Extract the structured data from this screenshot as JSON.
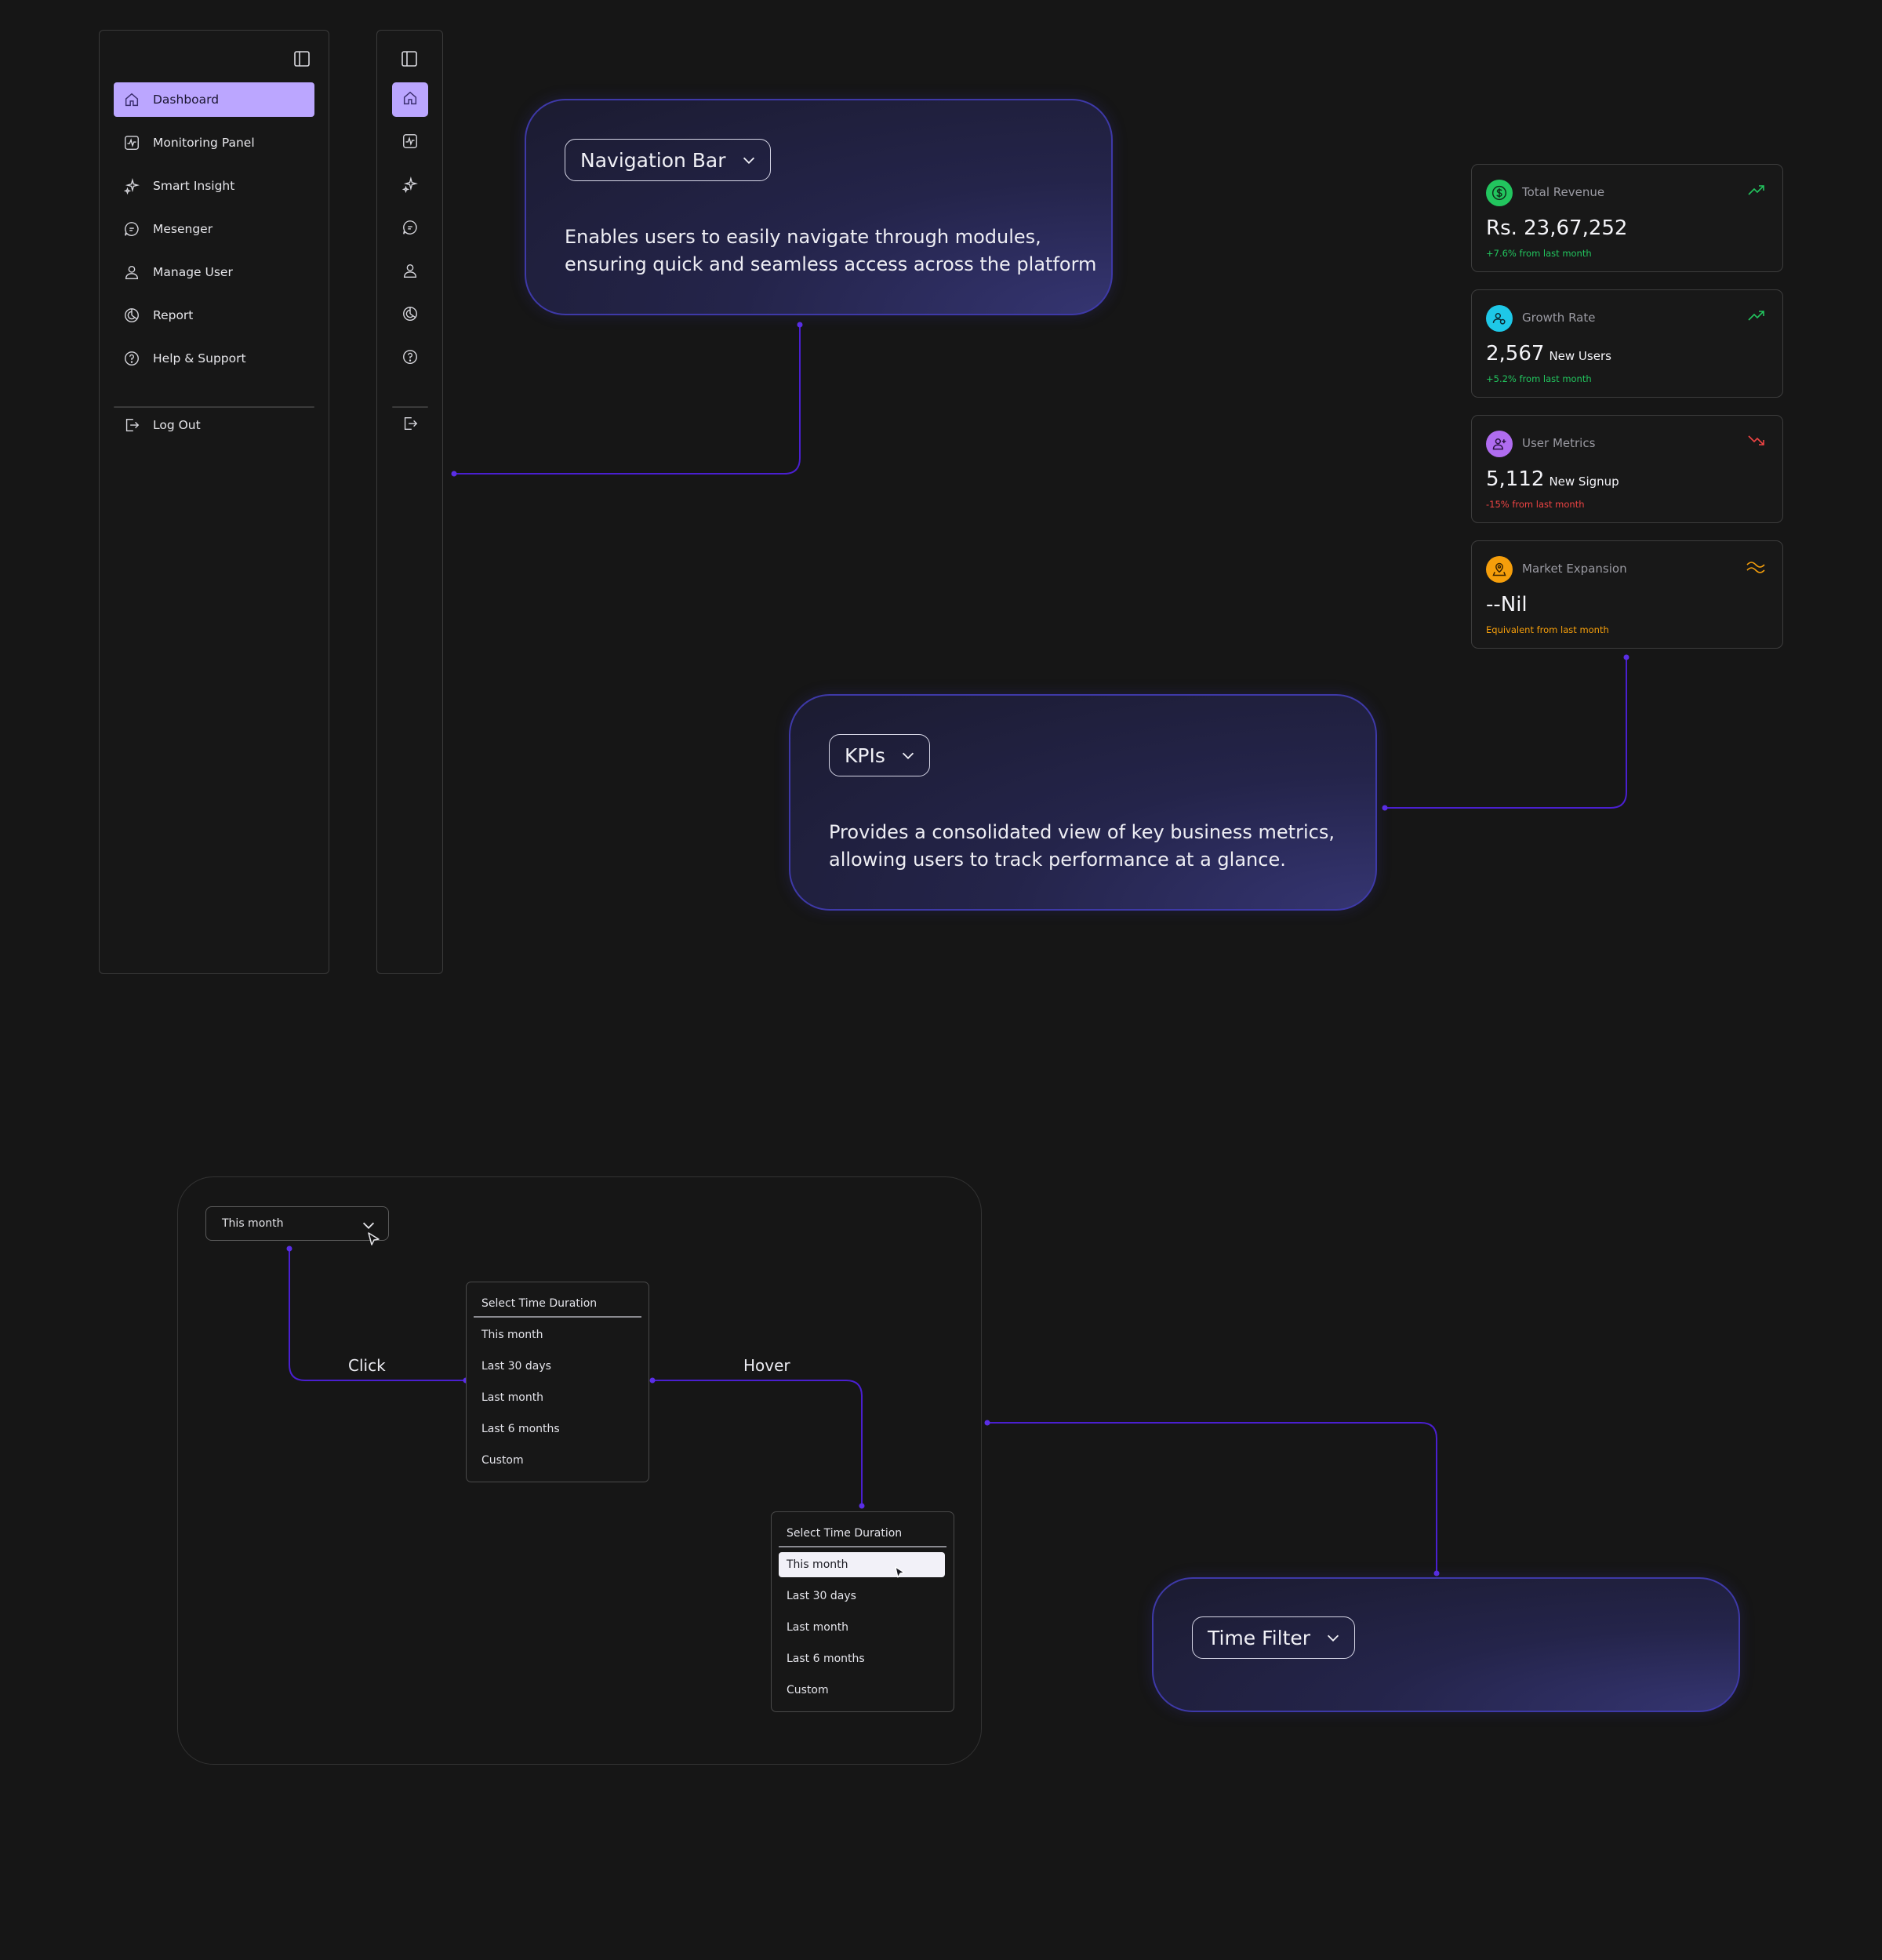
{
  "sidebar": {
    "items": [
      {
        "label": "Dashboard",
        "icon": "home-icon",
        "active": true
      },
      {
        "label": "Monitoring Panel",
        "icon": "monitoring-icon"
      },
      {
        "label": "Smart Insight",
        "icon": "sparkles-icon"
      },
      {
        "label": "Mesenger",
        "icon": "chat-icon"
      },
      {
        "label": "Manage User",
        "icon": "user-icon"
      },
      {
        "label": "Report",
        "icon": "pie-chart-icon"
      },
      {
        "label": "Help & Support",
        "icon": "help-icon"
      }
    ],
    "logout_label": "Log Out",
    "active_color": "#bba6ff"
  },
  "nav_card": {
    "pill": "Navigation Bar",
    "text_line1": "Enables users to easily navigate through modules,",
    "text_line2": "ensuring quick and seamless access across the platform"
  },
  "kpi_card": {
    "pill": "KPIs",
    "text_line1": "Provides a consolidated view of key business metrics,",
    "text_line2": "allowing users to track performance at a glance."
  },
  "time_filter_card": {
    "pill": "Time Filter"
  },
  "kpis": [
    {
      "title": "Total Revenue",
      "value": "Rs. 23,67,252",
      "unit": "",
      "change": "+7.6% from last month",
      "icon": "dollar-icon",
      "badge_color": "#22c55e",
      "change_color": "#22c55e",
      "trend": "up"
    },
    {
      "title": "Growth Rate",
      "value": "2,567",
      "unit": "New Users",
      "change": "+5.2% from last month",
      "icon": "users-icon",
      "badge_color": "#1ec8e8",
      "change_color": "#22c55e",
      "trend": "up"
    },
    {
      "title": "User Metrics",
      "value": "5,112",
      "unit": "New Signup",
      "change": "-15% from last month",
      "icon": "user-plus-icon",
      "badge_color": "#b06cf0",
      "change_color": "#ef4444",
      "trend": "down"
    },
    {
      "title": "Market Expansion",
      "value": "--Nil",
      "unit": "",
      "change": "Equivalent from last month",
      "icon": "map-pin-icon",
      "badge_color": "#f59e0b",
      "change_color": "#f59e0b",
      "trend": "flat"
    }
  ],
  "time_filter": {
    "select_value": "This month",
    "click_label": "Click",
    "hover_label": "Hover",
    "dropdown_title": "Select Time Duration",
    "options": [
      "This month",
      "Last 30 days",
      "Last month",
      "Last 6 months",
      "Custom"
    ]
  },
  "colors": {
    "background": "#161616",
    "connector": "#4a1fd0",
    "card_border": "#3e39a8"
  }
}
